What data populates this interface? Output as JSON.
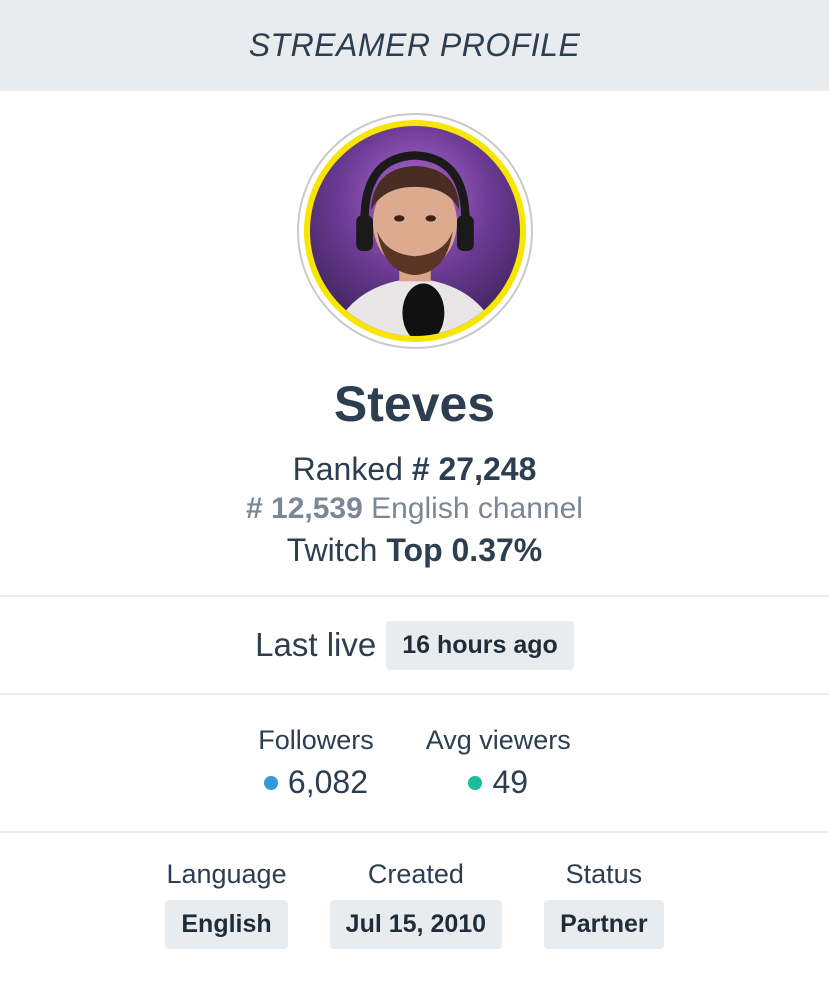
{
  "header": {
    "title": "STREAMER PROFILE"
  },
  "profile": {
    "name": "Steves",
    "ranked_label": "Ranked",
    "ranked_value": "# 27,248",
    "language_rank_value": "# 12,539",
    "language_rank_label": "English channel",
    "platform_label": "Twitch",
    "top_value": "Top 0.37%",
    "avatar_border_color": "#f7e600"
  },
  "last_live": {
    "label": "Last live",
    "value": "16 hours ago"
  },
  "stats": {
    "followers": {
      "label": "Followers",
      "value": "6,082",
      "dot_color": "#3498db"
    },
    "avg_viewers": {
      "label": "Avg viewers",
      "value": "49",
      "dot_color": "#1abc9c"
    }
  },
  "meta": {
    "language": {
      "label": "Language",
      "value": "English"
    },
    "created": {
      "label": "Created",
      "value": "Jul 15, 2010"
    },
    "status": {
      "label": "Status",
      "value": "Partner"
    }
  }
}
